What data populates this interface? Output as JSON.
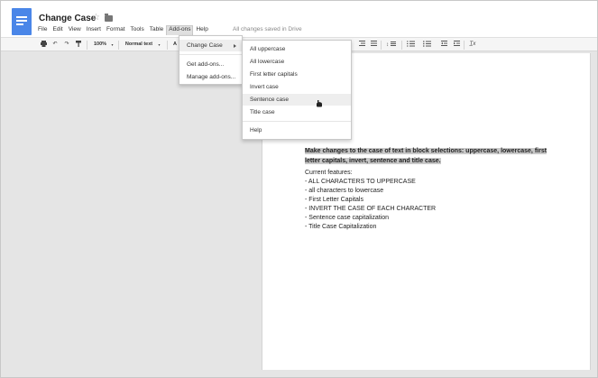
{
  "header": {
    "title": "Change Case",
    "save_status": "All changes saved in Drive",
    "menu": [
      "File",
      "Edit",
      "View",
      "Insert",
      "Format",
      "Tools",
      "Table",
      "Add-ons",
      "Help"
    ]
  },
  "toolbar": {
    "zoom": "100%",
    "style": "Normal text",
    "font_initial": "A",
    "clear_format_symbol": "T̲x"
  },
  "addons_menu": {
    "items": [
      "Change Case",
      "Get add-ons...",
      "Manage add-ons..."
    ]
  },
  "submenu": {
    "items": [
      "All uppercase",
      "All lowercase",
      "First letter capitals",
      "Invert case",
      "Sentence case",
      "Title case",
      "Help"
    ],
    "highlighted": "Sentence case"
  },
  "document": {
    "intro_line1": "Make changes to the case of text in block selections: uppercase, lowercase, first",
    "intro_line2": "letter capitals, invert, sentence and title case.",
    "features_heading": "Current features:",
    "features": [
      "- ALL CHARACTERS TO UPPERCASE",
      "- all characters to lowercase",
      "- First Letter Capitals",
      "- INVERT THE CASE OF EACH CHARACTER",
      "- Sentence case capitalization",
      "- Title Case Capitalization"
    ]
  },
  "colors": {
    "brand": "#4a86e8",
    "selection": "#c9c9c9"
  }
}
